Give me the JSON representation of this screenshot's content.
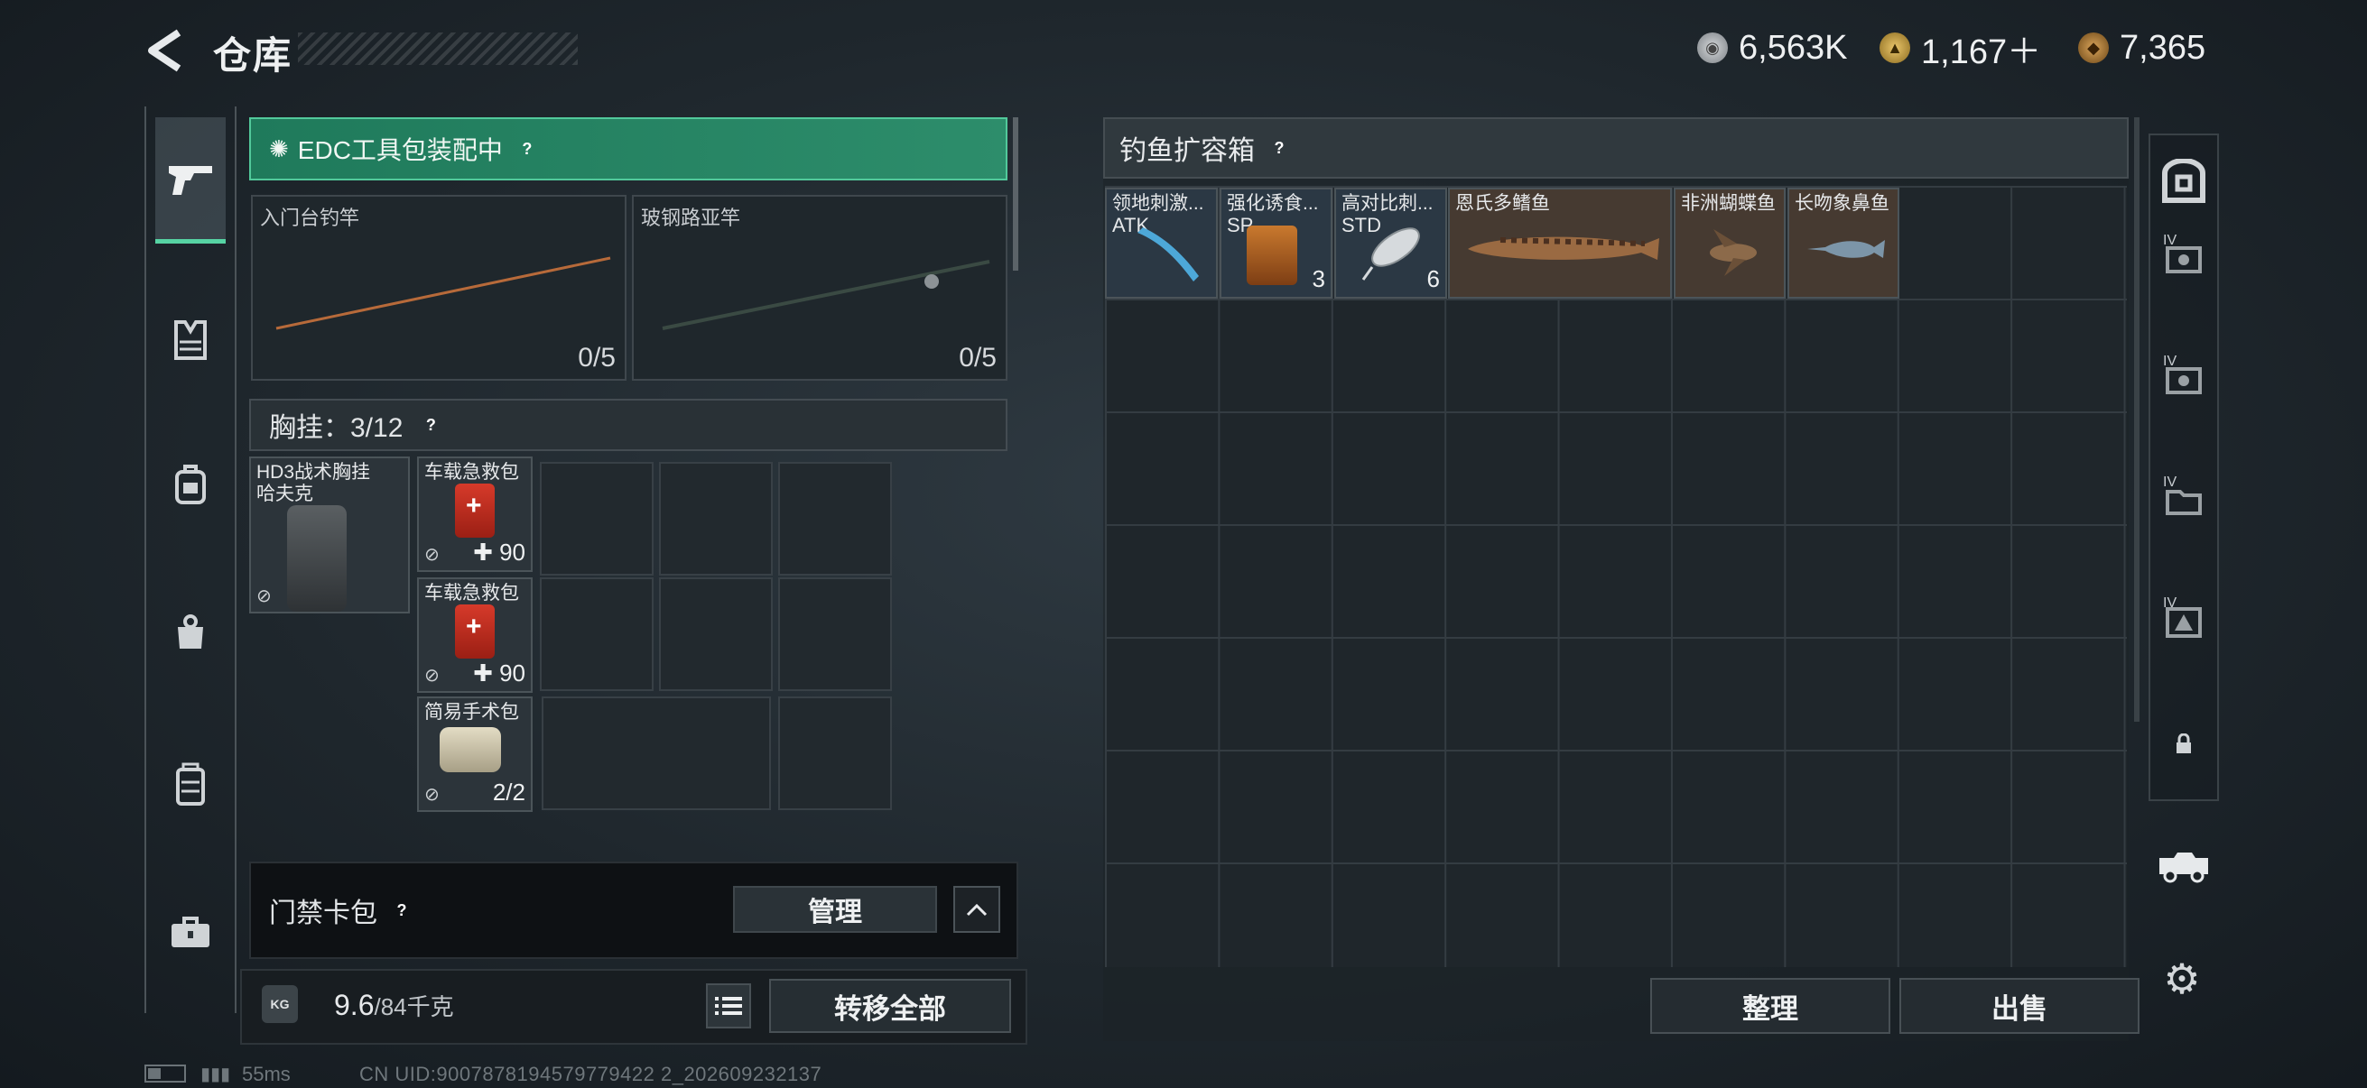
{
  "header": {
    "title": "仓库",
    "back_label": "back"
  },
  "currencies": {
    "silver": "6,563K",
    "tri": "1,167＋",
    "bronze": "7,365"
  },
  "left_rail": [
    "pistol-icon",
    "vest-icon",
    "backpack-icon",
    "bag-icon",
    "case-icon",
    "toolbox-icon"
  ],
  "edc": {
    "label": "EDC工具包装配中",
    "help": "?"
  },
  "rods": [
    {
      "label": "入门台钓竿",
      "count": "0/5"
    },
    {
      "label": "玻钢路亚竿",
      "count": "0/5"
    }
  ],
  "chest": {
    "label": "胸挂：3/12",
    "help": "?",
    "vest": {
      "label": "HD3战术胸挂\n哈夫克"
    },
    "items": [
      {
        "label": "车载急救包",
        "value": "90"
      },
      {
        "label": "车载急救包",
        "value": "90"
      },
      {
        "label": "简易手术包",
        "value": "2/2"
      }
    ]
  },
  "keycard": {
    "label": "门禁卡包",
    "help": "?",
    "manage": "管理",
    "collapse": "^"
  },
  "weight": {
    "icon": "KG",
    "current": "9.6",
    "max": "/84千克",
    "transfer": "转移全部"
  },
  "box": {
    "title": "钓鱼扩容箱",
    "help": "?",
    "items": [
      {
        "label": "领地刺激...",
        "sub": "ATK"
      },
      {
        "label": "强化诱食...",
        "sub": "SP",
        "count": "3"
      },
      {
        "label": "高对比刺...",
        "sub": "STD",
        "count": "6"
      },
      {
        "label": "恩氏多鳍鱼"
      },
      {
        "label": "非洲蝴蝶鱼"
      },
      {
        "label": "长吻象鼻鱼"
      }
    ],
    "sort": "整理",
    "sell": "出售"
  },
  "right_rail": {
    "tabs": [
      "IV",
      "IV",
      "IV",
      "IV"
    ]
  },
  "footer": {
    "ping": "55ms",
    "uid": "CN UID:9007878194579779422 2_202609232137"
  },
  "colors": {
    "accent": "#56d3a3",
    "edc_bg": "#2d8d6b"
  }
}
